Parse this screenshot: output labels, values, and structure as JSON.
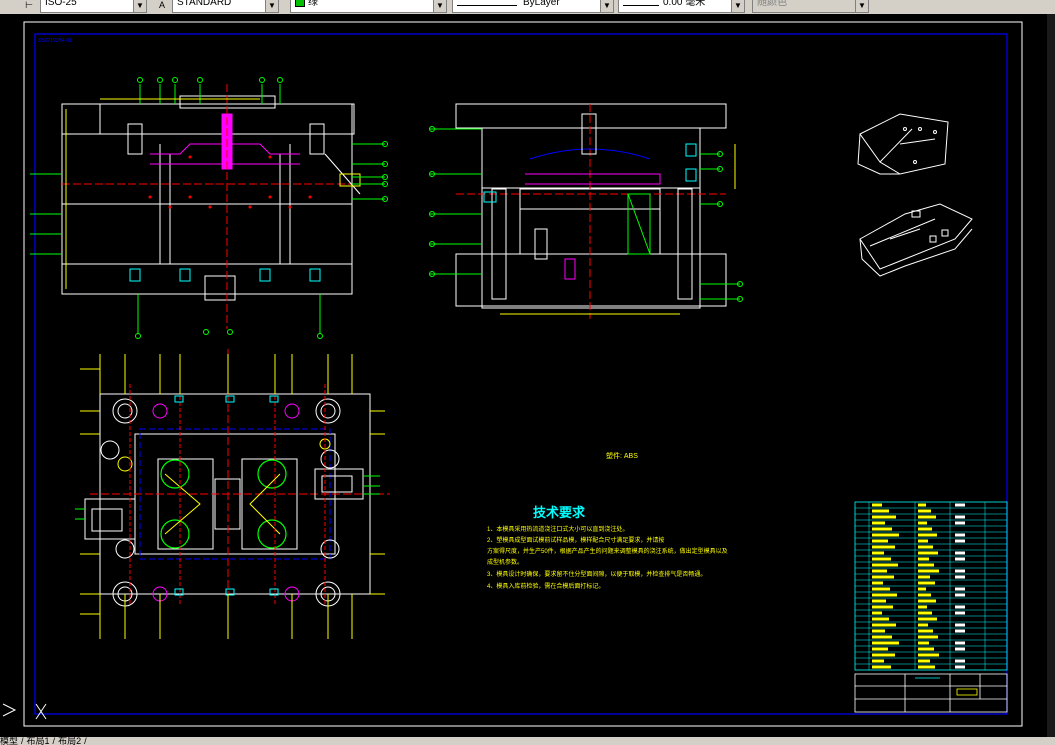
{
  "toolbar": {
    "scale_value": "ISO-25",
    "textstyle_value": "STANDARD",
    "color_value": "绿",
    "linetype_value": "ByLayer",
    "lineweight_value": "0.00 毫米",
    "plotstyle_value": "随颜色"
  },
  "drawing": {
    "frame_label": "XS07193B4-01",
    "part_label": "塑件: ABS",
    "tech_title": "技术要求",
    "tech_notes": [
      "1、本模具采用热流道浇注口式大小可以直到浇注处。",
      "2、塑模具成型面试模前试样品模，模样配合尺寸满足要求，并请按",
      "方案得尺度，并生产50件，根据产品产生的问题来调整模具的浇注系统，做出定型模具以及",
      "成型机参数。",
      "3、模具设计时确保，要求留不住分型面间隙，以便于取模，并检查排气是否畅通。",
      "4、模具入库前检验，需在合模后面打标记。"
    ],
    "colors": {
      "frame": "#0000ff",
      "outline": "#ffffff",
      "center": "#ff0000",
      "dim": "#00ff00",
      "accent": "#ffff00",
      "cyan": "#00ffff",
      "magenta": "#ff00ff"
    }
  },
  "tabs": {
    "model": "模型",
    "layout1": "布局1",
    "layout2": "布局2"
  },
  "ucs_icon": "ucs-icon"
}
